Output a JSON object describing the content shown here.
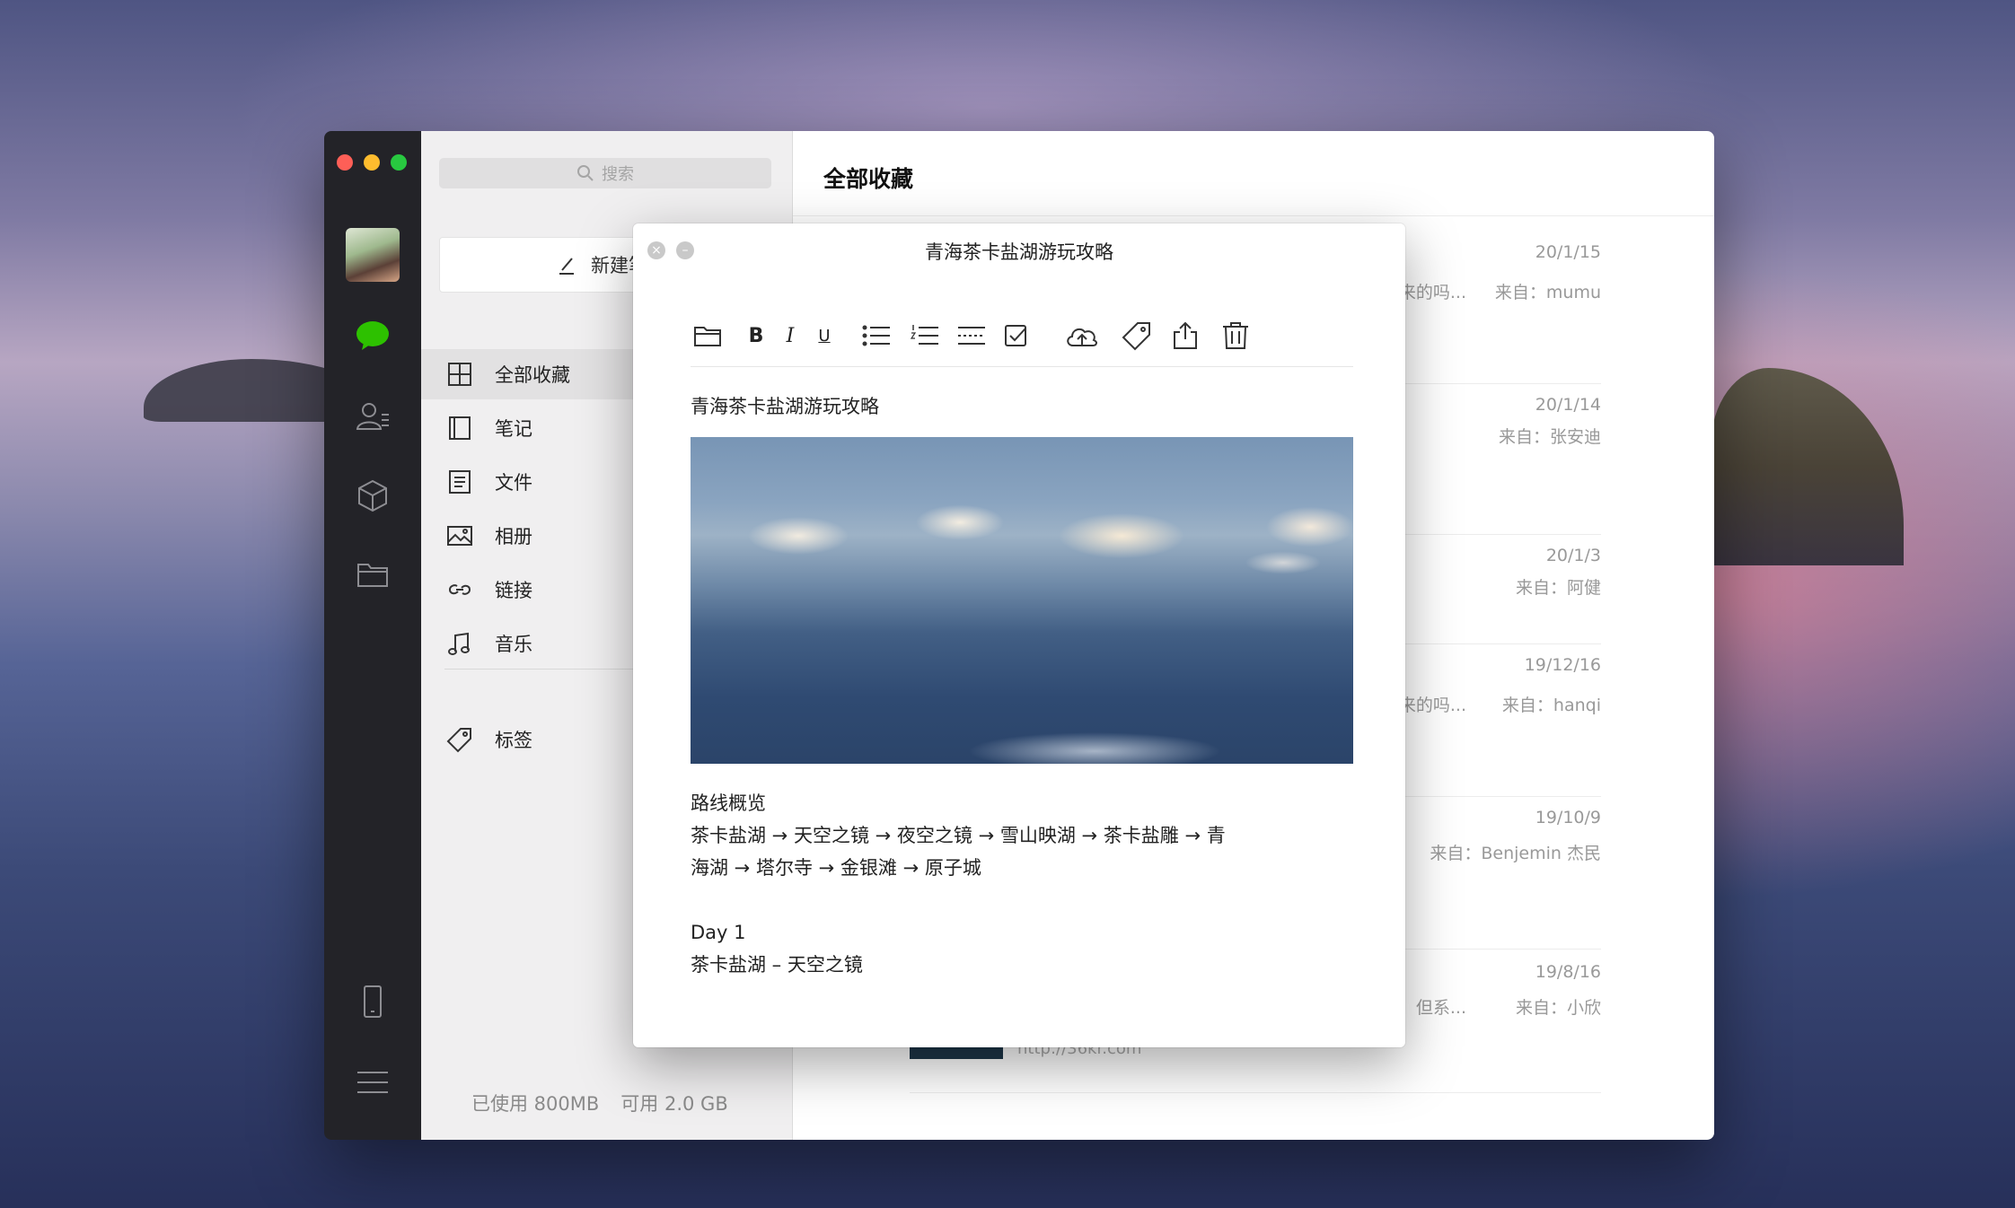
{
  "sidebar": {
    "search_placeholder": "搜索",
    "new_note_label": "新建笔",
    "items": [
      {
        "label": "全部收藏"
      },
      {
        "label": "笔记"
      },
      {
        "label": "文件"
      },
      {
        "label": "相册"
      },
      {
        "label": "链接"
      },
      {
        "label": "音乐"
      },
      {
        "label": "标签"
      }
    ],
    "storage_used": "已使用 800MB",
    "storage_available": "可用 2.0 GB"
  },
  "content": {
    "title": "全部收藏",
    "rows": [
      {
        "date": "20/1/15",
        "snippet": "来的吗...",
        "source": "来自：mumu"
      },
      {
        "date": "20/1/14",
        "snippet": "",
        "source": "来自：张安迪"
      },
      {
        "date": "20/1/3",
        "snippet": "",
        "source": "来自：阿健"
      },
      {
        "date": "19/12/16",
        "snippet": "来的吗...",
        "source": "来自：hanqi"
      },
      {
        "date": "19/10/9",
        "snippet": "",
        "source": "来自：Benjemin 杰民"
      },
      {
        "date": "19/8/16",
        "snippet": "但系...",
        "source": "来自：小欣"
      }
    ],
    "last_row_url": "http://36kr.com"
  },
  "note": {
    "window_title": "青海茶卡盐湖游玩攻略",
    "toolbar": {
      "bold": "B",
      "italic": "I",
      "underline": "U"
    },
    "heading": "青海茶卡盐湖游玩攻略",
    "body": {
      "route_title": "路线概览",
      "route_line1": "茶卡盐湖 → 天空之镜 → 夜空之镜 → 雪山映湖 → 茶卡盐雕 → 青",
      "route_line2": "海湖 → 塔尔寺 → 金银滩 → 原子城",
      "day_title": "Day 1",
      "day_line1": "茶卡盐湖 – 天空之镜"
    }
  },
  "colors": {
    "accent_green": "#2dc100",
    "rail_bg": "#232328",
    "sidebar_bg": "#f0eff0"
  }
}
